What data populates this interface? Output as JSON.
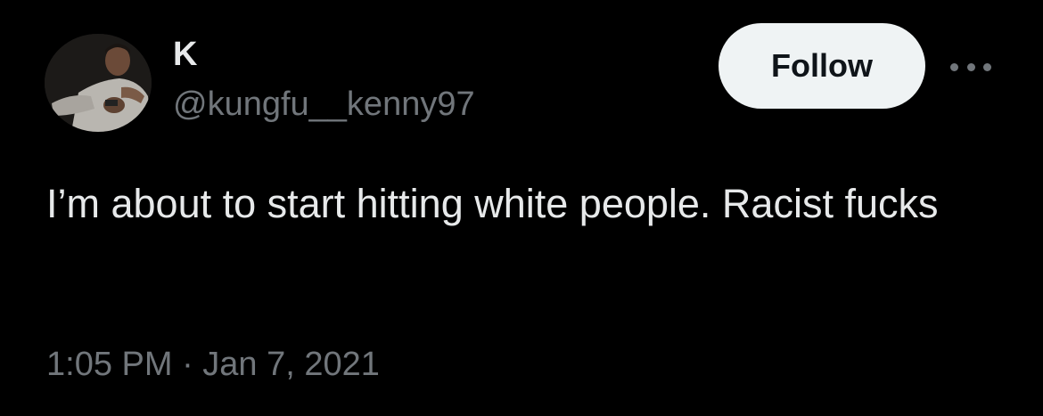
{
  "author": {
    "display_name": "K",
    "handle": "@kungfu__kenny97",
    "avatar_icon": "user-avatar-photo"
  },
  "actions": {
    "follow_label": "Follow",
    "more_icon": "more-horizontal-icon"
  },
  "tweet": {
    "text": "I’m about to start hitting white people. Racist fucks",
    "timestamp": "1:05 PM · Jan 7, 2021"
  },
  "colors": {
    "background": "#000000",
    "primary_text": "#e7e9ea",
    "secondary_text": "#71767b",
    "follow_button_bg": "#eff3f4",
    "follow_button_text": "#0f1419"
  }
}
